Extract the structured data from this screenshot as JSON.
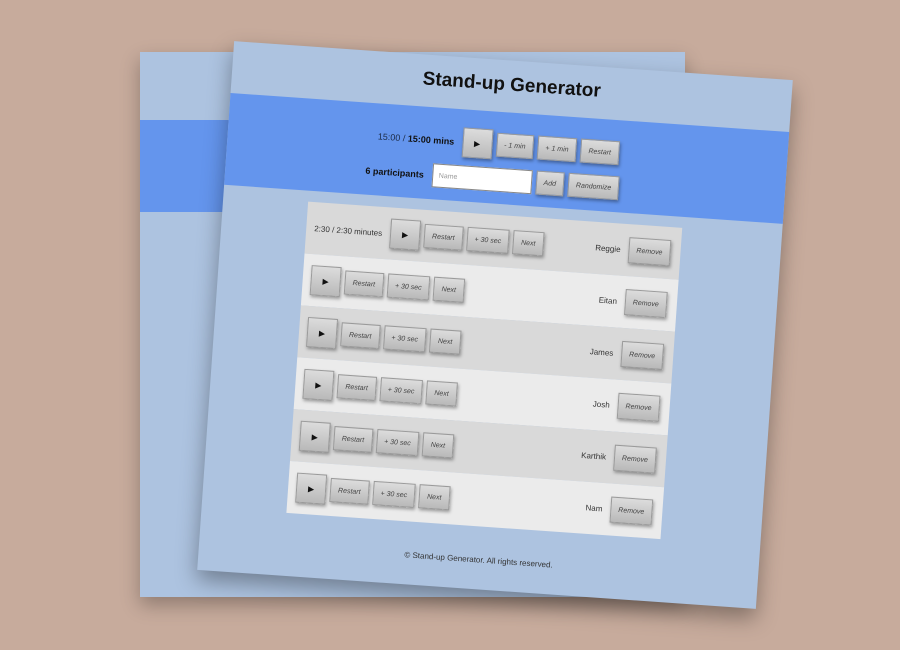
{
  "app": {
    "title": "Stand-up Generator"
  },
  "timer": {
    "elapsed": "15:00",
    "separator": " / ",
    "total": "15:00 mins",
    "play_icon": "▶",
    "minus_label": "- 1 min",
    "plus_label": "+ 1 min",
    "restart_label": "Restart"
  },
  "participants_bar": {
    "count_label": "6 participants",
    "name_placeholder": "Name",
    "add_label": "Add",
    "randomize_label": "Randomize"
  },
  "participants": [
    {
      "name": "Reggie",
      "time": "2:30 / 2:30 minutes",
      "active": true
    },
    {
      "name": "Eitan",
      "time": "",
      "active": false
    },
    {
      "name": "James",
      "time": "",
      "active": false
    },
    {
      "name": "Josh",
      "time": "",
      "active": false
    },
    {
      "name": "Karthik",
      "time": "",
      "active": false
    },
    {
      "name": "Nam",
      "time": "",
      "active": false
    }
  ],
  "row_buttons": {
    "play_icon": "▶",
    "restart_label": "Restart",
    "add_time_label": "+ 30 sec",
    "next_label": "Next",
    "remove_label": "Remove"
  },
  "footer": {
    "text": "© Stand-up Generator. All rights reserved."
  },
  "colors": {
    "page_bg": "#c7ab9c",
    "sheet_bg": "#adc3e0",
    "band_bg": "#6495ed",
    "row_odd": "#d9d9d9",
    "row_even": "#ebebeb"
  }
}
